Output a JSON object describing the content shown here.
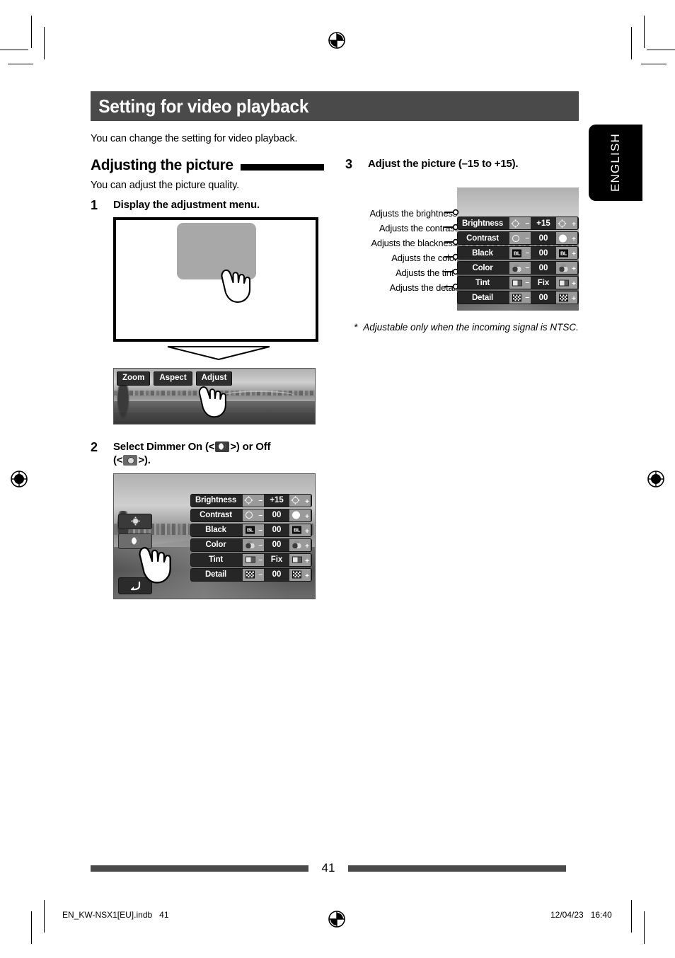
{
  "document": {
    "chapter_title": "Setting for video playback",
    "intro": "You can change the setting for video playback.",
    "language_tab": "ENGLISH",
    "page_number": "41",
    "footer_left": "EN_KW-NSX1[EU].indb   41",
    "footer_right": "12/04/23   16:40"
  },
  "section": {
    "heading": "Adjusting the picture",
    "lede": "You can adjust the picture quality."
  },
  "steps": {
    "one": {
      "number": "1",
      "text": "Display the adjustment menu."
    },
    "two": {
      "number": "2",
      "text_a": "Select Dimmer On (<",
      "text_b": ">) or Off",
      "text_c": "(<",
      "text_d": ">)."
    },
    "three": {
      "number": "3",
      "text": "Adjust the picture (–15 to +15)."
    }
  },
  "toolbar": {
    "buttons": [
      {
        "label": "Zoom"
      },
      {
        "label": "Aspect"
      },
      {
        "label": "Adjust"
      }
    ]
  },
  "dimmer_buttons": [
    {
      "name": "dimmer-off-sun"
    },
    {
      "name": "dimmer-on-moon"
    },
    {
      "name": "return-back"
    }
  ],
  "osd_menu": {
    "rows": [
      {
        "label": "Brightness",
        "value": "+15",
        "minus": "–",
        "plus": "+",
        "icon_minus": "sun-icon",
        "icon_plus": "sun-icon"
      },
      {
        "label": "Contrast",
        "value": "00",
        "minus": "–",
        "plus": "+",
        "icon_minus": "circle-outline-icon",
        "icon_plus": "circle-filled-icon"
      },
      {
        "label": "Black",
        "value": "00",
        "minus": "–",
        "plus": "+",
        "icon_minus": "bl-box-icon",
        "icon_plus": "bl-box-icon"
      },
      {
        "label": "Color",
        "value": "00",
        "minus": "–",
        "plus": "+",
        "icon_minus": "color-circles-icon",
        "icon_plus": "color-circles-icon"
      },
      {
        "label": "Tint",
        "value": "Fix",
        "minus": "–",
        "plus": "+",
        "icon_minus": "tint-bar-icon",
        "icon_plus": "tint-bar-icon"
      },
      {
        "label": "Detail",
        "value": "00",
        "minus": "–",
        "plus": "+",
        "icon_minus": "checker-icon",
        "icon_plus": "checker-icon"
      }
    ]
  },
  "callouts": [
    "Adjusts the brightness",
    "Adjusts the contrast",
    "Adjusts the blackness",
    "Adjusts the color",
    "Adjusts the tint*",
    "Adjusts the detail"
  ],
  "footnote": {
    "marker": "*",
    "text": "Adjustable only when the incoming signal is NTSC."
  },
  "colors": {
    "chapter_bar": "#4a4a4a",
    "rule": "#000000",
    "tab_bg": "#000000",
    "osd_row": "#262626",
    "osd_button": "#9a9a9a"
  }
}
